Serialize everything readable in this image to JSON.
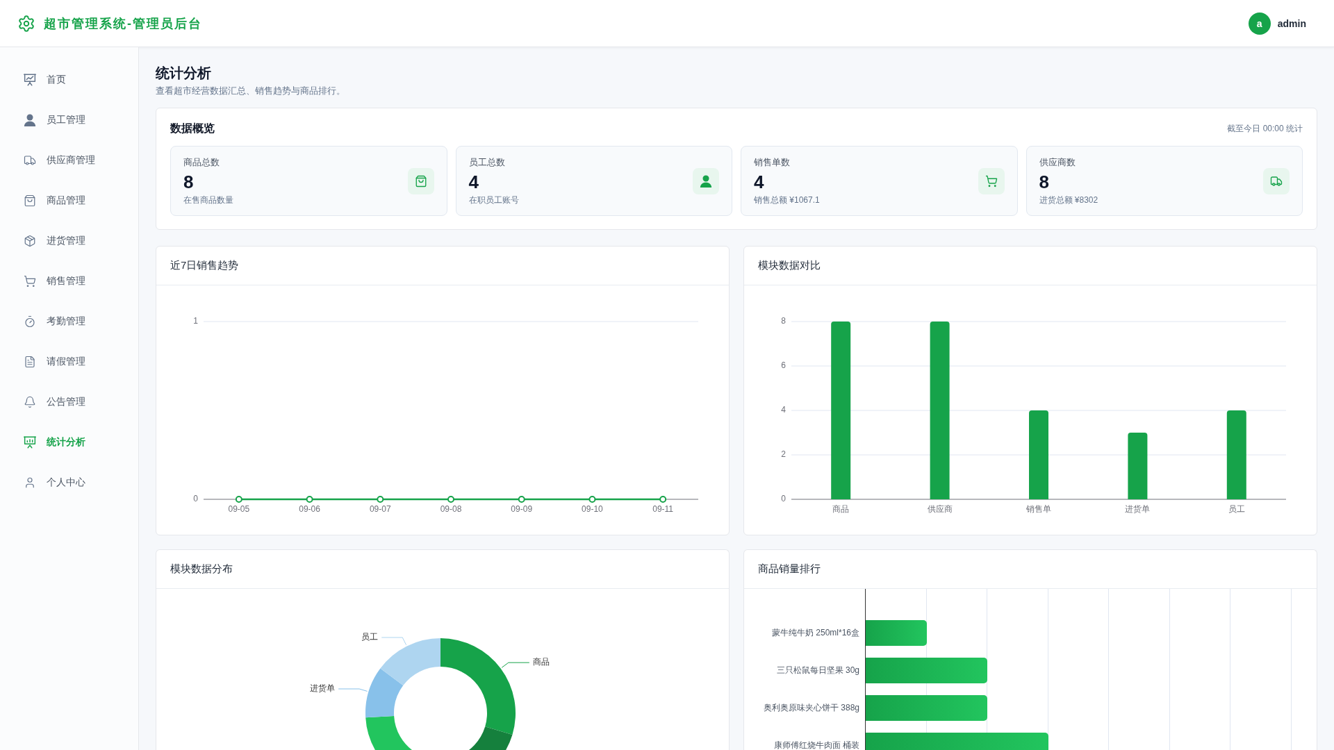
{
  "header": {
    "title": "超市管理系统-管理员后台",
    "user": {
      "avatar": "a",
      "name": "admin"
    }
  },
  "sidebar": {
    "items": [
      {
        "label": "首页",
        "selected": false
      },
      {
        "label": "员工管理",
        "selected": false
      },
      {
        "label": "供应商管理",
        "selected": false
      },
      {
        "label": "商品管理",
        "selected": false
      },
      {
        "label": "进货管理",
        "selected": false
      },
      {
        "label": "销售管理",
        "selected": false
      },
      {
        "label": "考勤管理",
        "selected": false
      },
      {
        "label": "请假管理",
        "selected": false
      },
      {
        "label": "公告管理",
        "selected": false
      },
      {
        "label": "统计分析",
        "selected": true
      },
      {
        "label": "个人中心",
        "selected": false
      }
    ]
  },
  "page": {
    "title": "统计分析",
    "subtitle": "查看超市经营数据汇总、销售趋势与商品排行。"
  },
  "overview": {
    "title": "数据概览",
    "note": "截至今日 00:00 统计",
    "stats": [
      {
        "label": "商品总数",
        "value": "8",
        "caption": "在售商品数量"
      },
      {
        "label": "员工总数",
        "value": "4",
        "caption": "在职员工账号"
      },
      {
        "label": "销售单数",
        "value": "4",
        "caption": "销售总额 ¥1067.1"
      },
      {
        "label": "供应商数",
        "value": "8",
        "caption": "进货总额 ¥8302"
      }
    ]
  },
  "sales_trend": {
    "title": "近7日销售趋势",
    "chart_data": {
      "type": "line",
      "categories": [
        "09-05",
        "09-06",
        "09-07",
        "09-08",
        "09-09",
        "09-10",
        "09-11"
      ],
      "values": [
        0,
        0,
        0,
        0,
        0,
        0,
        0
      ],
      "ylim": [
        0,
        1
      ],
      "yticks": [
        0,
        1
      ],
      "grid": true,
      "marker": true
    }
  },
  "module_comparison": {
    "title": "模块数据对比",
    "chart_data": {
      "type": "bar",
      "categories": [
        "商品",
        "供应商",
        "销售单",
        "进货单",
        "员工"
      ],
      "values": [
        8,
        8,
        4,
        3,
        4
      ],
      "ylim": [
        0,
        8
      ],
      "yticks": [
        0,
        2,
        4,
        6,
        8
      ],
      "grid": true
    }
  },
  "module_distribution": {
    "title": "模块数据分布",
    "slices": [
      {
        "label": "商品",
        "color": "#16a34a"
      },
      {
        "color": "#15803d"
      },
      {
        "color": "#22c55e"
      },
      {
        "label": "进货单",
        "color": "#88c1ea"
      },
      {
        "label": "员工",
        "color": "#aed5f0"
      }
    ]
  },
  "product_ranking": {
    "title": "商品销量排行",
    "items": [
      {
        "name": "蒙牛纯牛奶 250ml*16盒",
        "level": 0.143
      },
      {
        "name": "三只松鼠每日坚果 30g",
        "level": 0.286
      },
      {
        "name": "奥利奥原味夹心饼干 388g",
        "level": 0.286
      },
      {
        "name": "康师傅红烧牛肉面 桶装",
        "level": 0.429
      }
    ]
  }
}
